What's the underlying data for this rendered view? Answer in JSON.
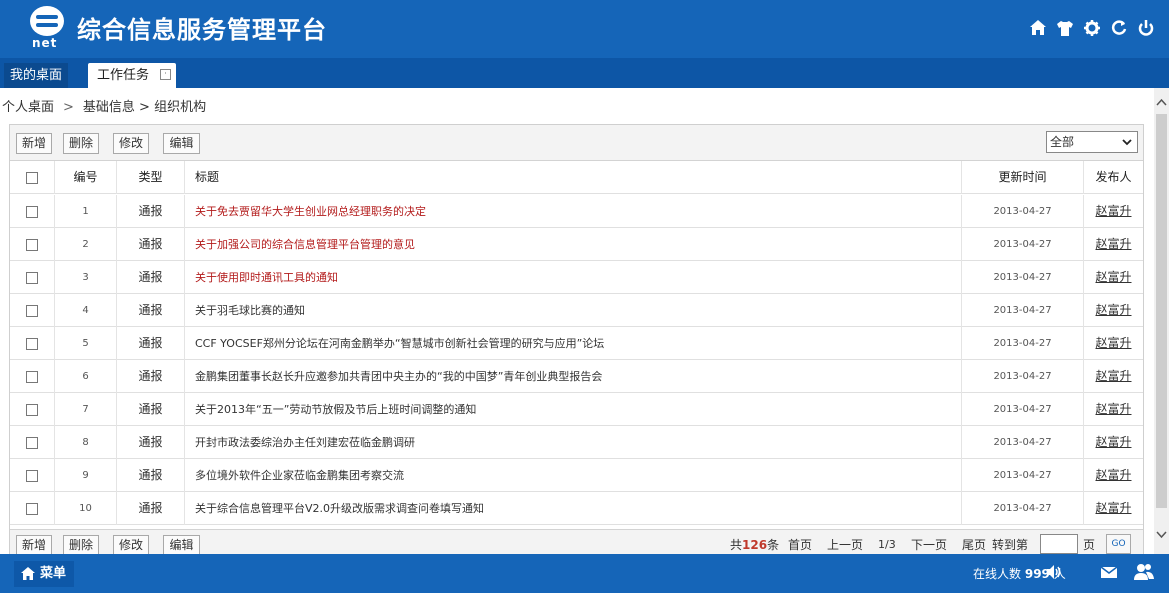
{
  "app": {
    "logo_text": "net",
    "title": "综合信息服务管理平台"
  },
  "header_icons": [
    "home-icon",
    "shirt-icon",
    "gear-icon",
    "refresh-icon",
    "power-icon"
  ],
  "tabs": [
    {
      "label": "我的桌面"
    },
    {
      "label": "工作任务"
    }
  ],
  "breadcrumb": {
    "root": "个人桌面",
    "separator": ">",
    "path": "基础信息 > 组织机构"
  },
  "toolbar": {
    "add_label": "新增",
    "delete_label": "删除",
    "edit_label": "修改",
    "modify_label": "编辑",
    "filter_value": "全部"
  },
  "table": {
    "columns": {
      "no": "编号",
      "type": "类型",
      "title": "标题",
      "time": "更新时间",
      "publisher": "发布人"
    },
    "rows": [
      {
        "no": "1",
        "type": "通报",
        "title": "关于免去贾留华大学生创业网总经理职务的决定",
        "time": "2013-04-27",
        "publisher": "赵富升",
        "hot": true
      },
      {
        "no": "2",
        "type": "通报",
        "title": "关于加强公司的综合信息管理平台管理的意见",
        "time": "2013-04-27",
        "publisher": "赵富升",
        "hot": true
      },
      {
        "no": "3",
        "type": "通报",
        "title": "关于使用即时通讯工具的通知",
        "time": "2013-04-27",
        "publisher": "赵富升",
        "hot": true
      },
      {
        "no": "4",
        "type": "通报",
        "title": "关于羽毛球比赛的通知",
        "time": "2013-04-27",
        "publisher": "赵富升",
        "hot": false
      },
      {
        "no": "5",
        "type": "通报",
        "title": "CCF YOCSEF郑州分论坛在河南金鹏举办“智慧城市创新社会管理的研究与应用”论坛",
        "time": "2013-04-27",
        "publisher": "赵富升",
        "hot": false
      },
      {
        "no": "6",
        "type": "通报",
        "title": "金鹏集团董事长赵长升应邀参加共青团中央主办的“我的中国梦”青年创业典型报告会",
        "time": "2013-04-27",
        "publisher": "赵富升",
        "hot": false
      },
      {
        "no": "7",
        "type": "通报",
        "title": "关于2013年“五一”劳动节放假及节后上班时间调整的通知",
        "time": "2013-04-27",
        "publisher": "赵富升",
        "hot": false
      },
      {
        "no": "8",
        "type": "通报",
        "title": "开封市政法委综治办主任刘建宏莅临金鹏调研",
        "time": "2013-04-27",
        "publisher": "赵富升",
        "hot": false
      },
      {
        "no": "9",
        "type": "通报",
        "title": "多位境外软件企业家莅临金鹏集团考察交流",
        "time": "2013-04-27",
        "publisher": "赵富升",
        "hot": false
      },
      {
        "no": "10",
        "type": "通报",
        "title": "关于综合信息管理平台V2.0升级改版需求调查问卷填写通知",
        "time": "2013-04-27",
        "publisher": "赵富升",
        "hot": false
      }
    ]
  },
  "pager": {
    "total_prefix": "共",
    "total_count": "126",
    "total_suffix": "条",
    "first": "首页",
    "prev": "上一页",
    "page_info": "1/3",
    "next": "下一页",
    "last": "尾页",
    "goto_label": "转到第",
    "page_unit": "页",
    "go": "GO"
  },
  "footer": {
    "menu_label": "菜单",
    "online_label": "在线人数",
    "online_count": "999",
    "online_unit": "人"
  },
  "colors": {
    "header_blue": "#1565b8",
    "hot_title": "#b31b1b"
  }
}
